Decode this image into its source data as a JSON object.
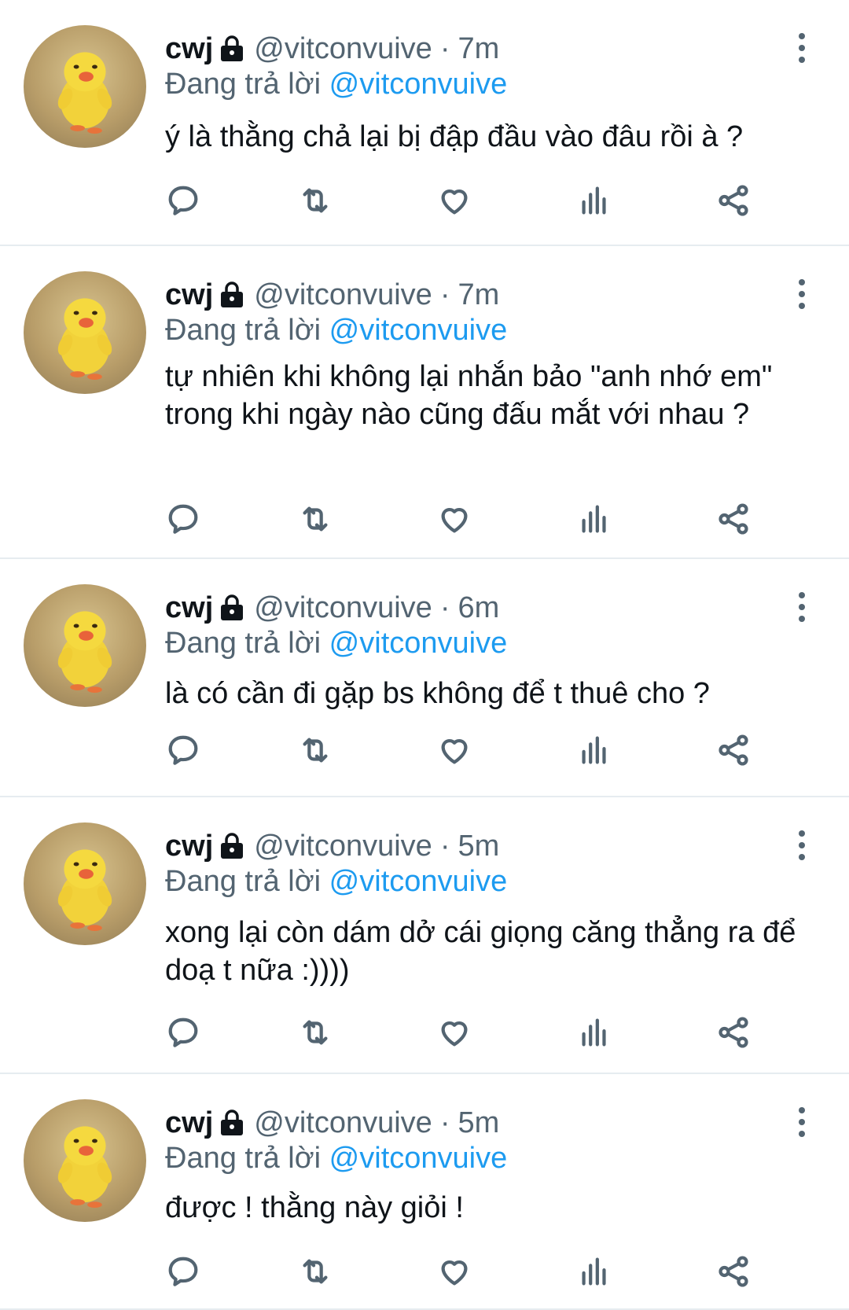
{
  "tweets": [
    {
      "name": "cwj",
      "handle": "@vitconvuive",
      "time": "7m",
      "replying_prefix": "Đang trả lời",
      "replying_to": "@vitconvuive",
      "text": "ý là thằng chả lại bị đập đầu vào đâu rồi à ?"
    },
    {
      "name": "cwj",
      "handle": "@vitconvuive",
      "time": "7m",
      "replying_prefix": "Đang trả lời",
      "replying_to": "@vitconvuive",
      "text": "tự nhiên khi không lại nhắn bảo \"anh nhớ em\" trong khi ngày nào cũng đấu mắt với nhau ?"
    },
    {
      "name": "cwj",
      "handle": "@vitconvuive",
      "time": "6m",
      "replying_prefix": "Đang trả lời",
      "replying_to": "@vitconvuive",
      "text": "là có cần đi gặp bs không để t thuê cho ?"
    },
    {
      "name": "cwj",
      "handle": "@vitconvuive",
      "time": "5m",
      "replying_prefix": "Đang trả lời",
      "replying_to": "@vitconvuive",
      "text": "xong lại còn dám dở cái giọng căng thẳng ra để doạ t nữa :))))"
    },
    {
      "name": "cwj",
      "handle": "@vitconvuive",
      "time": "5m",
      "replying_prefix": "Đang trả lời",
      "replying_to": "@vitconvuive",
      "text": "được ! thằng này giỏi !"
    }
  ],
  "separator": "·",
  "icons": {
    "lock": "lock-icon",
    "more": "more-vertical-icon",
    "reply": "reply-icon",
    "retweet": "retweet-icon",
    "like": "like-icon",
    "analytics": "analytics-icon",
    "share": "share-icon"
  },
  "colors": {
    "mention": "#1d9bf0",
    "secondary_text": "#536471",
    "divider": "#e6ecf0"
  }
}
